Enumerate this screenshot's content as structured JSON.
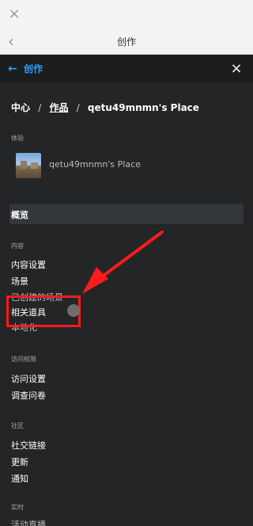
{
  "browser": {
    "close_icon": "×",
    "back_icon": "‹",
    "title": "创作"
  },
  "header": {
    "back_icon": "←",
    "title": "创作",
    "close_icon": "×"
  },
  "breadcrumb": {
    "items": [
      "中心",
      "作品",
      "qetu49mnmn's Place"
    ],
    "separator": "/"
  },
  "experience": {
    "section_label": "体验",
    "name": "qetu49mnmn's Place"
  },
  "overview": {
    "label": "概览"
  },
  "sections": {
    "content": {
      "label": "内容",
      "items": [
        "内容设置",
        "场景",
        "已创建的场景",
        "相关道具",
        "本地化"
      ]
    },
    "access": {
      "label": "访问权限",
      "items": [
        "访问设置",
        "调查问卷"
      ]
    },
    "community": {
      "label": "社区",
      "items": [
        "社交链接",
        "更新",
        "通知"
      ]
    },
    "realtime": {
      "label": "实时",
      "items": [
        "活动直播"
      ]
    }
  },
  "annotation": {
    "highlight_color": "#ff1b1b"
  }
}
